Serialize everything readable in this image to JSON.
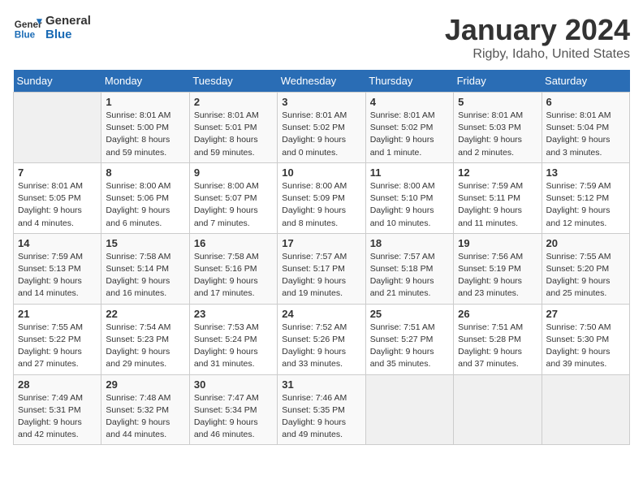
{
  "header": {
    "logo_line1": "General",
    "logo_line2": "Blue",
    "title": "January 2024",
    "subtitle": "Rigby, Idaho, United States"
  },
  "weekdays": [
    "Sunday",
    "Monday",
    "Tuesday",
    "Wednesday",
    "Thursday",
    "Friday",
    "Saturday"
  ],
  "weeks": [
    [
      {
        "day": "",
        "info": ""
      },
      {
        "day": "1",
        "info": "Sunrise: 8:01 AM\nSunset: 5:00 PM\nDaylight: 8 hours\nand 59 minutes."
      },
      {
        "day": "2",
        "info": "Sunrise: 8:01 AM\nSunset: 5:01 PM\nDaylight: 8 hours\nand 59 minutes."
      },
      {
        "day": "3",
        "info": "Sunrise: 8:01 AM\nSunset: 5:02 PM\nDaylight: 9 hours\nand 0 minutes."
      },
      {
        "day": "4",
        "info": "Sunrise: 8:01 AM\nSunset: 5:02 PM\nDaylight: 9 hours\nand 1 minute."
      },
      {
        "day": "5",
        "info": "Sunrise: 8:01 AM\nSunset: 5:03 PM\nDaylight: 9 hours\nand 2 minutes."
      },
      {
        "day": "6",
        "info": "Sunrise: 8:01 AM\nSunset: 5:04 PM\nDaylight: 9 hours\nand 3 minutes."
      }
    ],
    [
      {
        "day": "7",
        "info": "Sunrise: 8:01 AM\nSunset: 5:05 PM\nDaylight: 9 hours\nand 4 minutes."
      },
      {
        "day": "8",
        "info": "Sunrise: 8:00 AM\nSunset: 5:06 PM\nDaylight: 9 hours\nand 6 minutes."
      },
      {
        "day": "9",
        "info": "Sunrise: 8:00 AM\nSunset: 5:07 PM\nDaylight: 9 hours\nand 7 minutes."
      },
      {
        "day": "10",
        "info": "Sunrise: 8:00 AM\nSunset: 5:09 PM\nDaylight: 9 hours\nand 8 minutes."
      },
      {
        "day": "11",
        "info": "Sunrise: 8:00 AM\nSunset: 5:10 PM\nDaylight: 9 hours\nand 10 minutes."
      },
      {
        "day": "12",
        "info": "Sunrise: 7:59 AM\nSunset: 5:11 PM\nDaylight: 9 hours\nand 11 minutes."
      },
      {
        "day": "13",
        "info": "Sunrise: 7:59 AM\nSunset: 5:12 PM\nDaylight: 9 hours\nand 12 minutes."
      }
    ],
    [
      {
        "day": "14",
        "info": "Sunrise: 7:59 AM\nSunset: 5:13 PM\nDaylight: 9 hours\nand 14 minutes."
      },
      {
        "day": "15",
        "info": "Sunrise: 7:58 AM\nSunset: 5:14 PM\nDaylight: 9 hours\nand 16 minutes."
      },
      {
        "day": "16",
        "info": "Sunrise: 7:58 AM\nSunset: 5:16 PM\nDaylight: 9 hours\nand 17 minutes."
      },
      {
        "day": "17",
        "info": "Sunrise: 7:57 AM\nSunset: 5:17 PM\nDaylight: 9 hours\nand 19 minutes."
      },
      {
        "day": "18",
        "info": "Sunrise: 7:57 AM\nSunset: 5:18 PM\nDaylight: 9 hours\nand 21 minutes."
      },
      {
        "day": "19",
        "info": "Sunrise: 7:56 AM\nSunset: 5:19 PM\nDaylight: 9 hours\nand 23 minutes."
      },
      {
        "day": "20",
        "info": "Sunrise: 7:55 AM\nSunset: 5:20 PM\nDaylight: 9 hours\nand 25 minutes."
      }
    ],
    [
      {
        "day": "21",
        "info": "Sunrise: 7:55 AM\nSunset: 5:22 PM\nDaylight: 9 hours\nand 27 minutes."
      },
      {
        "day": "22",
        "info": "Sunrise: 7:54 AM\nSunset: 5:23 PM\nDaylight: 9 hours\nand 29 minutes."
      },
      {
        "day": "23",
        "info": "Sunrise: 7:53 AM\nSunset: 5:24 PM\nDaylight: 9 hours\nand 31 minutes."
      },
      {
        "day": "24",
        "info": "Sunrise: 7:52 AM\nSunset: 5:26 PM\nDaylight: 9 hours\nand 33 minutes."
      },
      {
        "day": "25",
        "info": "Sunrise: 7:51 AM\nSunset: 5:27 PM\nDaylight: 9 hours\nand 35 minutes."
      },
      {
        "day": "26",
        "info": "Sunrise: 7:51 AM\nSunset: 5:28 PM\nDaylight: 9 hours\nand 37 minutes."
      },
      {
        "day": "27",
        "info": "Sunrise: 7:50 AM\nSunset: 5:30 PM\nDaylight: 9 hours\nand 39 minutes."
      }
    ],
    [
      {
        "day": "28",
        "info": "Sunrise: 7:49 AM\nSunset: 5:31 PM\nDaylight: 9 hours\nand 42 minutes."
      },
      {
        "day": "29",
        "info": "Sunrise: 7:48 AM\nSunset: 5:32 PM\nDaylight: 9 hours\nand 44 minutes."
      },
      {
        "day": "30",
        "info": "Sunrise: 7:47 AM\nSunset: 5:34 PM\nDaylight: 9 hours\nand 46 minutes."
      },
      {
        "day": "31",
        "info": "Sunrise: 7:46 AM\nSunset: 5:35 PM\nDaylight: 9 hours\nand 49 minutes."
      },
      {
        "day": "",
        "info": ""
      },
      {
        "day": "",
        "info": ""
      },
      {
        "day": "",
        "info": ""
      }
    ]
  ]
}
